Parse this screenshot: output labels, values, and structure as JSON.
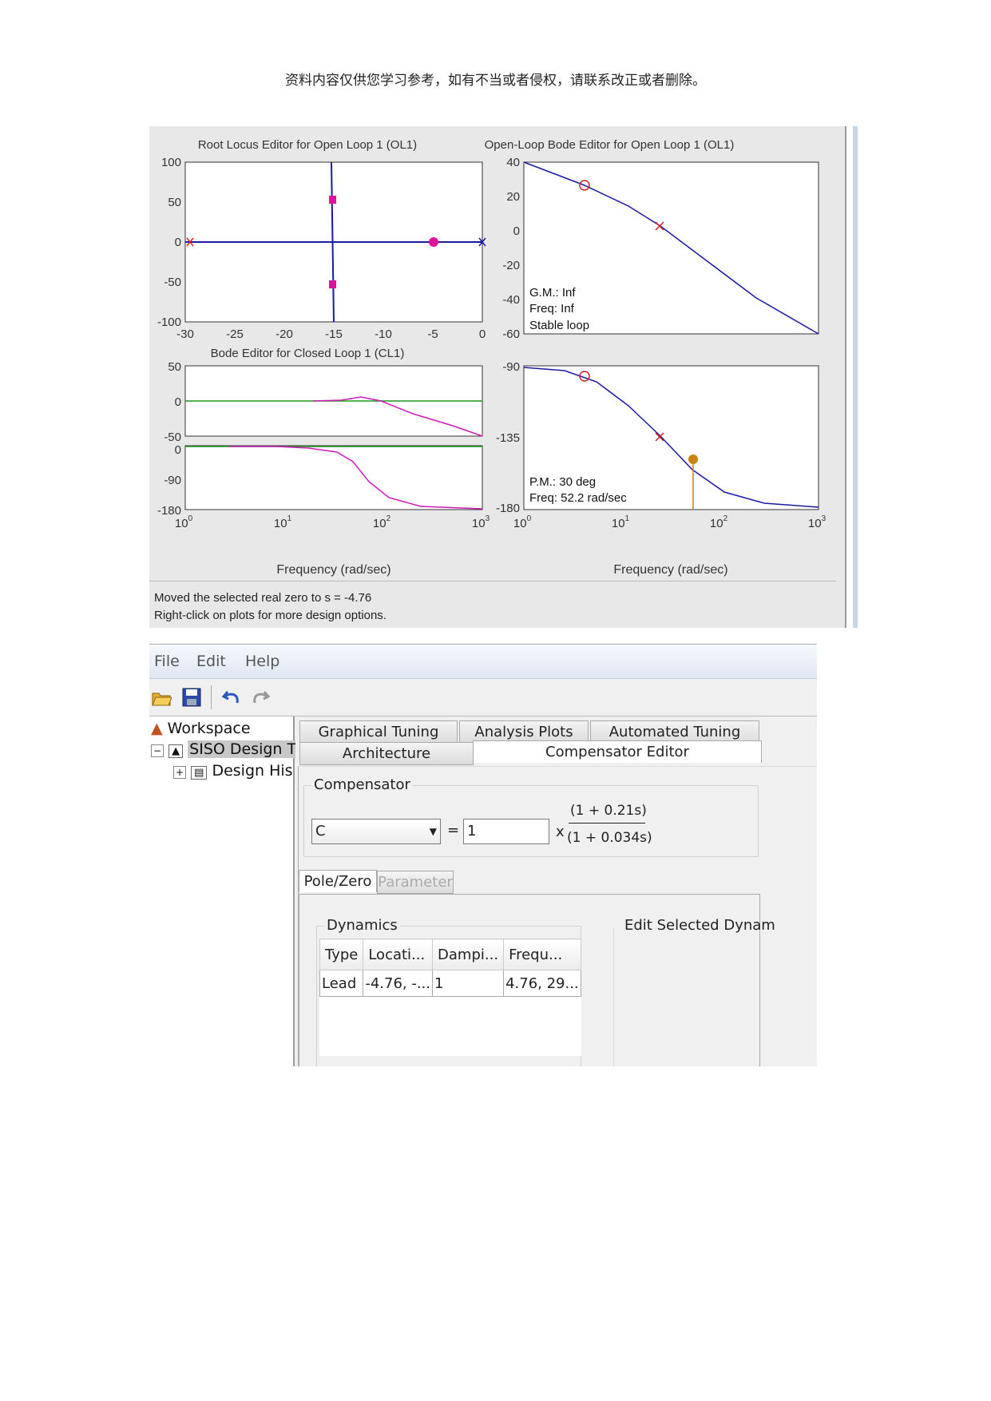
{
  "header": {
    "notice": "资料内容仅供您学习参考，如有不当或者侵权，请联系改正或者删除。"
  },
  "figure": {
    "root_locus": {
      "title": "Root Locus Editor for Open Loop 1 (OL1)",
      "y_ticks": [
        "100",
        "50",
        "0",
        "-50",
        "-100"
      ],
      "x_ticks": [
        "-30",
        "-25",
        "-20",
        "-15",
        "-10",
        "-5",
        "0"
      ]
    },
    "cl_bode": {
      "title": "Bode Editor for Closed Loop 1 (CL1)",
      "mag_ticks": [
        "50",
        "0",
        "-50"
      ],
      "phase_ticks": [
        "0",
        "-90",
        "-180"
      ],
      "xlabel": "Frequency (rad/sec)"
    },
    "ol_bode": {
      "title": "Open-Loop Bode Editor for Open Loop 1 (OL1)",
      "mag_ticks": [
        "40",
        "20",
        "0",
        "-20",
        "-40",
        "-60"
      ],
      "phase_ticks": [
        "-90",
        "-135",
        "-180"
      ],
      "gm_text": "G.M.: Inf",
      "gm_freq": "Freq: Inf",
      "stability": "Stable loop",
      "pm_text": "P.M.: 30 deg",
      "pm_freq": "Freq: 52.2 rad/sec",
      "xlabel": "Frequency (rad/sec)"
    },
    "freq_tick_base": "10",
    "freq_tick_exps": [
      "0",
      "1",
      "2",
      "3"
    ],
    "status_line1": "Moved the selected real zero to s = -4.76",
    "status_line2": "Right-click on plots for more design options."
  },
  "gui": {
    "menu": {
      "file": "File",
      "edit": "Edit",
      "help": "Help"
    },
    "toolbar_icons": [
      "open-icon",
      "save-icon",
      "undo-icon",
      "redo-icon"
    ],
    "tree": {
      "workspace": "Workspace",
      "siso": "SISO Design T",
      "history": "Design His"
    },
    "tabs": {
      "graphical": "Graphical Tuning",
      "analysis": "Analysis Plots",
      "automated": "Automated Tuning",
      "architecture": "Architecture",
      "compensator": "Compensator Editor"
    },
    "compensator": {
      "legend": "Compensator",
      "select_value": "C",
      "equals": "=",
      "gain": "1",
      "times": "x",
      "numerator": "(1 + 0.21s)",
      "denominator": "(1 + 0.034s)"
    },
    "subtabs": {
      "polezero": "Pole/Zero",
      "parameter": "Parameter"
    },
    "dynamics": {
      "legend": "Dynamics",
      "edit_selected": "Edit Selected Dynam",
      "columns": [
        "Type",
        "Locati...",
        "Dampi...",
        "Frequ..."
      ],
      "rows": [
        [
          "Lead",
          "-4.76, -...",
          "1",
          "4.76, 29..."
        ]
      ]
    }
  }
}
